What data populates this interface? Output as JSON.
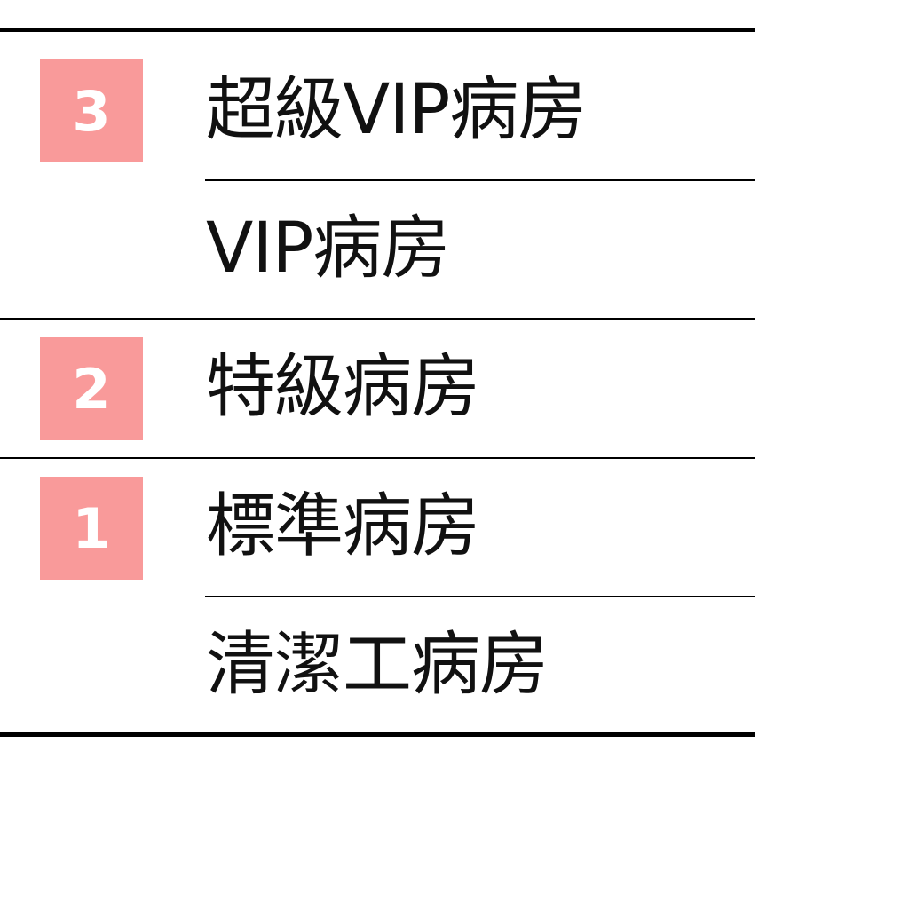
{
  "accent_color": "#f99a9a",
  "groups": [
    {
      "level": "3",
      "items": [
        "超級VIP病房",
        "VIP病房"
      ]
    },
    {
      "level": "2",
      "items": [
        "特級病房"
      ]
    },
    {
      "level": "1",
      "items": [
        "標準病房",
        "清潔工病房"
      ]
    }
  ]
}
